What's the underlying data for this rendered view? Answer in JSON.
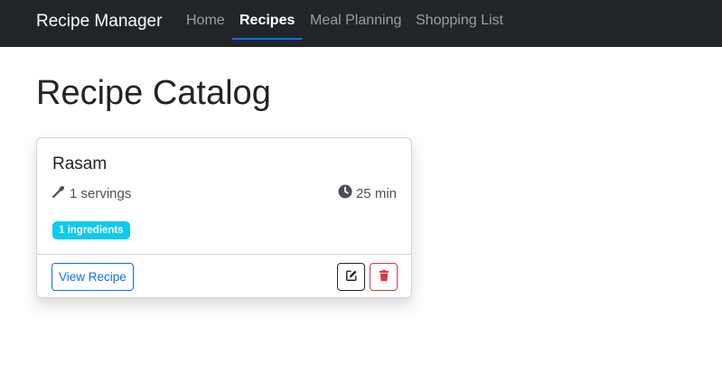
{
  "nav": {
    "brand": "Recipe Manager",
    "items": [
      {
        "label": "Home",
        "active": false
      },
      {
        "label": "Recipes",
        "active": true
      },
      {
        "label": "Meal Planning",
        "active": false
      },
      {
        "label": "Shopping List",
        "active": false
      }
    ]
  },
  "page": {
    "title": "Recipe Catalog"
  },
  "recipes": [
    {
      "name": "Rasam",
      "servings": "1 servings",
      "time": "25 min",
      "ingredients_badge": "1 ingredients",
      "view_label": "View Recipe",
      "icons": {
        "servings": "spoon-icon",
        "time": "clock-icon",
        "edit": "edit-icon",
        "delete": "trash-icon"
      }
    }
  ],
  "colors": {
    "navbar_bg": "#212529",
    "primary": "#0d6efd",
    "info": "#0dcaf0",
    "danger": "#dc3545"
  }
}
